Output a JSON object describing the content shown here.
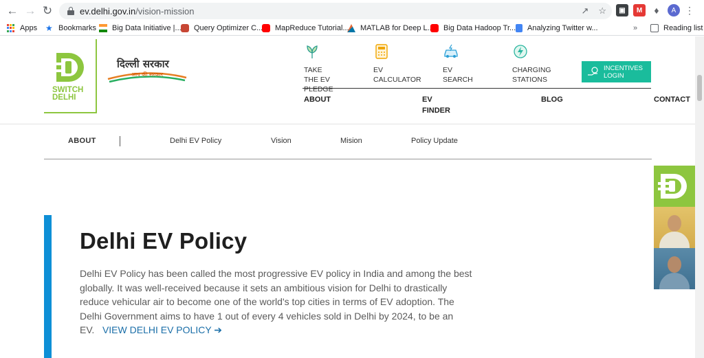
{
  "browser": {
    "url_domain": "ev.delhi.gov.in",
    "url_path": "/vision-mission",
    "avatar_letter": "A",
    "bookmarks": [
      {
        "label": "Apps",
        "icon": "apps-grid-icon"
      },
      {
        "label": "Bookmarks",
        "icon": "star-icon"
      },
      {
        "label": "Big Data Initiative |...",
        "icon": "india-flag-icon"
      },
      {
        "label": "Query Optimizer C...",
        "icon": "oracle-icon"
      },
      {
        "label": "MapReduce Tutorial...",
        "icon": "youtube-icon"
      },
      {
        "label": "MATLAB for Deep L...",
        "icon": "matlab-icon"
      },
      {
        "label": "Big Data Hadoop Tr...",
        "icon": "youtube-icon"
      },
      {
        "label": "Analyzing Twitter w...",
        "icon": "doc-icon"
      }
    ],
    "reading_list": "Reading list",
    "more_chevron": "»"
  },
  "header": {
    "logo_line1": "SWITCH",
    "logo_line2": "DELHI",
    "gov_hindi": "दिल्ली सरकार",
    "gov_sub": "आप की सरकार",
    "actions": [
      {
        "line1": "TAKE THE EV",
        "line2": "PLEDGE",
        "icon": "pledge-leaf-icon"
      },
      {
        "line1": "EV CALCULATOR",
        "line2": "",
        "icon": "calculator-icon"
      },
      {
        "line1": "EV SEARCH",
        "line2": "",
        "icon": "ev-car-icon"
      },
      {
        "line1": "CHARGING",
        "line2": "STATIONS",
        "icon": "charging-icon"
      }
    ],
    "incentives_line1": "INCENTIVES",
    "incentives_line2": "LOGIN",
    "nav": [
      {
        "line1": "ABOUT",
        "line2": ""
      },
      {
        "line1": "EV",
        "line2": "FINDER"
      },
      {
        "line1": "BLOG",
        "line2": ""
      },
      {
        "line1": "CONTACT",
        "line2": ""
      }
    ]
  },
  "subnav": {
    "section": "ABOUT",
    "items": [
      "Delhi EV Policy",
      "Vision",
      "Mision",
      "Policy Update"
    ]
  },
  "content": {
    "title": "Delhi EV Policy",
    "body": "Delhi EV Policy has been called the most progressive EV policy in India and among the best globally. It was well-received because it sets an ambitious vision for Delhi to drastically reduce vehicular air to become one of the world's top cities in terms of EV adoption. The Delhi Government aims to have 1 out of every 4 vehicles sold in Delhi by 2024, to be an EV.",
    "link": "VIEW DELHI EV POLICY ➔"
  },
  "colors": {
    "brand_green": "#8dc63f",
    "accent_blue": "#0e8fd6",
    "teal_button": "#1abc9c",
    "link_blue": "#1a6ea8"
  }
}
